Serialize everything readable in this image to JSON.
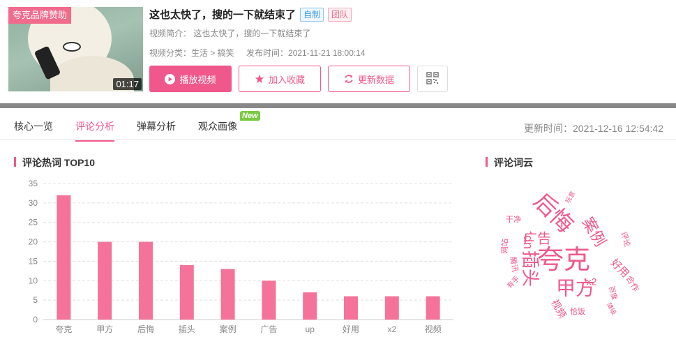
{
  "video": {
    "sponsor_label": "夸克品牌赞助",
    "duration": "01:17",
    "title": "这也太快了，搜的一下就结束了",
    "tags": [
      "自制",
      "团队"
    ],
    "description": "视频简介：  这也太快了，搜的一下就结束了",
    "category": "视频分类：生活 > 搞笑",
    "publish_time": "发布时间：2021-11-21 18:00:14"
  },
  "actions": {
    "play": "播放视频",
    "favorite": "加入收藏",
    "refresh": "更新数据"
  },
  "tabs": [
    {
      "label": "核心一览"
    },
    {
      "label": "评论分析"
    },
    {
      "label": "弹幕分析"
    },
    {
      "label": "观众画像"
    }
  ],
  "new_badge": "New",
  "update_time": "更新时间：2021-12-16 12:54:42",
  "sections": {
    "hotwords": "评论热词 TOP10",
    "wordcloud": "评论词云"
  },
  "colors": {
    "accent": "#f0588b",
    "bar": "#f5739a",
    "cloud": "#f0588b"
  },
  "chart_data": {
    "type": "bar",
    "title": "评论热词 TOP10",
    "categories": [
      "夸克",
      "甲方",
      "后悔",
      "插头",
      "案例",
      "广告",
      "up",
      "好用",
      "x2",
      "视频"
    ],
    "values": [
      32,
      20,
      20,
      14,
      13,
      10,
      7,
      6,
      6,
      6
    ],
    "ylim": [
      0,
      35
    ],
    "yticks": [
      0,
      5,
      10,
      15,
      20,
      25,
      30,
      35
    ],
    "grid": true
  },
  "wordcloud": [
    {
      "text": "夸克",
      "size": 38
    },
    {
      "text": "后悔",
      "size": 32
    },
    {
      "text": "甲方",
      "size": 28
    },
    {
      "text": "插头",
      "size": 26
    },
    {
      "text": "案例",
      "size": 22
    },
    {
      "text": "广告",
      "size": 20
    },
    {
      "text": "up",
      "size": 18
    },
    {
      "text": "好用",
      "size": 15
    },
    {
      "text": "x2",
      "size": 14
    },
    {
      "text": "视频",
      "size": 14
    },
    {
      "text": "合作",
      "size": 12
    },
    {
      "text": "评论",
      "size": 11
    },
    {
      "text": "网站",
      "size": 11
    },
    {
      "text": "干净",
      "size": 11
    },
    {
      "text": "恰饭",
      "size": 11
    },
    {
      "text": "腾讯",
      "size": 11
    },
    {
      "text": "有手",
      "size": 10
    },
    {
      "text": "百度",
      "size": 10
    },
    {
      "text": "降级",
      "size": 9
    },
    {
      "text": "玩意",
      "size": 9
    }
  ]
}
